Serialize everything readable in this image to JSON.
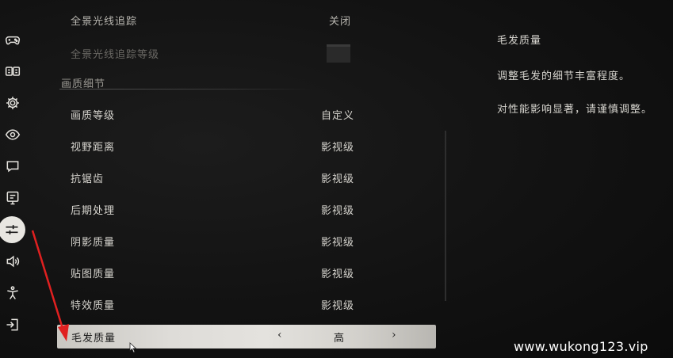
{
  "settings": {
    "rows_top": [
      {
        "label": "全景光线追踪",
        "value": "关闭"
      },
      {
        "label": "全景光线追踪等级",
        "value": ""
      }
    ],
    "section_title": "画质细节",
    "rows": [
      {
        "label": "画质等级",
        "value": "自定义"
      },
      {
        "label": "视野距离",
        "value": "影视级"
      },
      {
        "label": "抗锯齿",
        "value": "影视级"
      },
      {
        "label": "后期处理",
        "value": "影视级"
      },
      {
        "label": "阴影质量",
        "value": "影视级"
      },
      {
        "label": "贴图质量",
        "value": "影视级"
      },
      {
        "label": "特效质量",
        "value": "影视级"
      }
    ],
    "selected": {
      "label": "毛发质量",
      "value": "高",
      "prev_glyph": "‹",
      "next_glyph": "›"
    }
  },
  "description": {
    "title": "毛发质量",
    "lines": [
      "调整毛发的细节丰富程度。",
      "对性能影响显著，请谨慎调整。"
    ]
  },
  "sidebar": {
    "icons": [
      "gamepad-icon",
      "keyboard-icon",
      "gear-icon",
      "eye-icon",
      "chat-icon",
      "monitor-icon",
      "sliders-icon",
      "speaker-icon",
      "accessibility-icon",
      "exit-icon"
    ],
    "active_index": 6
  },
  "watermark": "www.wukong123.vip",
  "colors": {
    "selected_bg": "#e0deda",
    "annotation_arrow": "#e02020"
  }
}
